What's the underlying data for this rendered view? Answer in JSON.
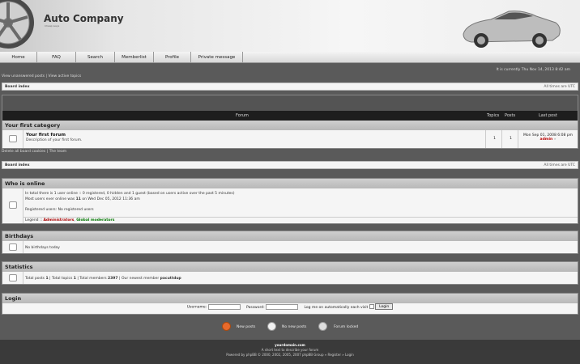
{
  "header": {
    "title": "Auto Company",
    "subtitle": "Cheap ways"
  },
  "nav": [
    {
      "label": "Home",
      "w": 46
    },
    {
      "label": "FAQ",
      "w": 48
    },
    {
      "label": "Search",
      "w": 48
    },
    {
      "label": "Memberlist",
      "w": 48
    },
    {
      "label": "Profile",
      "w": 46
    },
    {
      "label": "Private message",
      "w": 64
    }
  ],
  "toplinks": {
    "unanswered": "View unanswered posts",
    "sep": "|",
    "active": "View active topics"
  },
  "datetime": "It is currently Thu Nov 14, 2013 8:42 am",
  "navbar": {
    "board_index": "Board index",
    "timezone": "All times are UTC"
  },
  "forum": {
    "col_forum": "Forum",
    "col_topics": "Topics",
    "col_posts": "Posts",
    "col_last": "Last post",
    "category": "Your first category",
    "row": {
      "title": "Your first forum",
      "desc": "Description of your first forum.",
      "topics": "1",
      "posts": "1",
      "last_date": "Mon Sep 01, 2008 6:08 pm",
      "last_user": "admin"
    }
  },
  "boardlinks": {
    "delete_cookies": "Delete all board cookies",
    "sep": "|",
    "team": "The team"
  },
  "online": {
    "heading": "Who is online",
    "line1": "In total there is 1 user online :: 0 registered, 0 hidden and 1 guest (based on users active over the past 5 minutes)",
    "line2_pre": "Most users ever online was ",
    "line2_num": "11",
    "line2_post": " on Wed Dec 05, 2012 11:36 am",
    "registered": "Registered users: No registered users",
    "legend_label": "Legend :: ",
    "legend_admin": "Administrators",
    "legend_sep": ", ",
    "legend_mod": "Global moderators"
  },
  "birthdays": {
    "heading": "Birthdays",
    "text": "No birthdays today"
  },
  "statistics": {
    "heading": "Statistics",
    "pre": "Total posts ",
    "posts": "1",
    "mid1": " | Total topics ",
    "topics": "1",
    "mid2": " | Total members ",
    "members": "2397",
    "mid3": " | Our newest member ",
    "newest": "pacuttdup"
  },
  "login": {
    "heading": "Login",
    "username_label": "Username:",
    "password_label": "Password:",
    "remember_label": "Log me on automatically each visit",
    "button": "Login"
  },
  "legend": {
    "new_posts": "New posts",
    "no_new_posts": "No new posts",
    "forum_locked": "Forum locked"
  },
  "footer": {
    "site": "yourdomain.com",
    "tagline": "A short text to describe your forum",
    "powered": "Powered by phpBB © 2000, 2002, 2005, 2007 phpBB Group",
    "sep": " » ",
    "register": "Register",
    "sep2": " » ",
    "login": "Login"
  },
  "colors": {
    "accent_admin": "#aa0000",
    "accent_mod": "#007700",
    "dark_bg": "#5a5a5a"
  }
}
